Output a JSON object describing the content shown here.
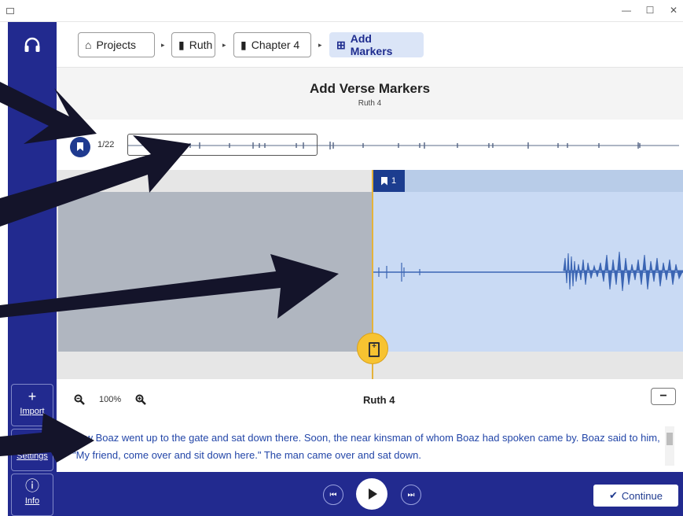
{
  "breadcrumbs": [
    {
      "label": "Projects",
      "icon": "home-icon"
    },
    {
      "label": "Ruth",
      "icon": "book-icon"
    },
    {
      "label": "Chapter 4",
      "icon": "file-icon"
    },
    {
      "label": "Add Markers",
      "icon": "add-marker-icon"
    }
  ],
  "header": {
    "title": "Add Verse Markers",
    "subtitle": "Ruth 4"
  },
  "overview": {
    "counter": "1/22"
  },
  "marker": {
    "label": "1"
  },
  "zoom": {
    "percent": "100%"
  },
  "chapter_label": "Ruth 4",
  "collapse_label": "−",
  "verse_text": "Now Boaz went up to the gate and sat down there. Soon, the near kinsman of whom Boaz had spoken came by. Boaz said to him, \"My friend, come over and sit down here.\" The man came over and sat down.",
  "sidebar": {
    "import": "Import",
    "settings": "Settings",
    "info": "Info"
  },
  "transport": {
    "continue": "Continue"
  },
  "colors": {
    "accent": "#222a8f",
    "marker_blue": "#1c3d8f",
    "highlight": "#f7c331",
    "wave": "#3b65b3"
  },
  "window_controls": [
    "—",
    "☐",
    "✕"
  ]
}
